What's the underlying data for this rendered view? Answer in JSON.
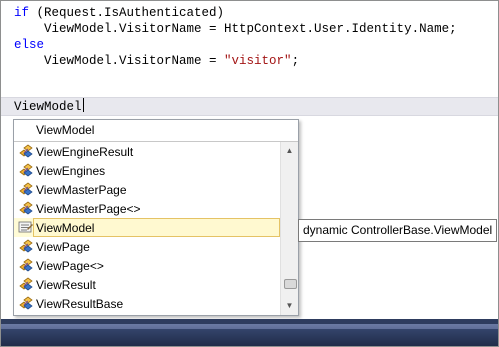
{
  "code": {
    "line1_kw": "if",
    "line1_rest": " (Request.IsAuthenticated)",
    "line2": "    ViewModel.VisitorName = HttpContext.User.Identity.Name;",
    "line3_kw": "else",
    "line4_pre": "    ViewModel.VisitorName = ",
    "line4_str": "\"visitor\"",
    "line4_post": ";",
    "typed": "ViewModel"
  },
  "intellisense": {
    "filter_text": "ViewModel",
    "items": [
      {
        "label": "ViewEngineResult",
        "icon": "class-icon"
      },
      {
        "label": "ViewEngines",
        "icon": "class-icon"
      },
      {
        "label": "ViewMasterPage",
        "icon": "class-icon"
      },
      {
        "label": "ViewMasterPage<>",
        "icon": "class-icon"
      },
      {
        "label": "ViewModel",
        "icon": "property-icon",
        "selected": true
      },
      {
        "label": "ViewPage",
        "icon": "class-icon"
      },
      {
        "label": "ViewPage<>",
        "icon": "class-icon"
      },
      {
        "label": "ViewResult",
        "icon": "class-icon"
      },
      {
        "label": "ViewResultBase",
        "icon": "class-icon"
      }
    ],
    "tooltip": "dynamic ControllerBase.ViewModel"
  },
  "colors": {
    "keyword": "#0000ff",
    "string": "#a31515",
    "selection_border": "#e5c365",
    "status_bar": "#2e3c5e"
  }
}
